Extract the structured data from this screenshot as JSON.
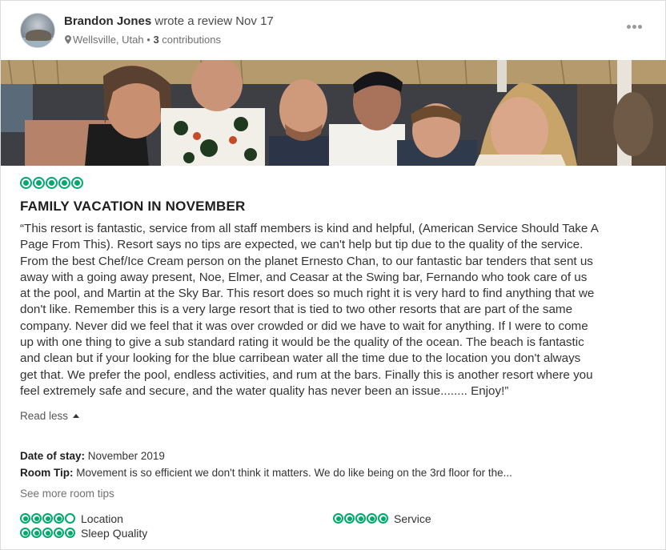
{
  "review": {
    "reviewer_name": "Brandon Jones",
    "action": "wrote a review Nov 17",
    "location": "Wellsville, Utah",
    "separator": "•",
    "contributions_count": "3",
    "contributions_label": "contributions",
    "rating": 5,
    "rating_max": 5,
    "title": "FAMILY VACATION IN NOVEMBER",
    "body_lines": [
      "“This resort is fantastic, service from all staff members is kind and helpful, (American Service Should Take A",
      "Page From This). Resort says no tips are expected, we can't help but tip due to the quality of the service.",
      "From the best Chef/Ice Cream person on the planet Ernesto Chan, to our fantastic bar tenders that sent us",
      "away with a going away present, Noe, Elmer, and Ceasar at the Swing bar, Fernando who took care of us",
      "at the pool, and Martin at the Sky Bar. This resort does so much right it is very hard to find anything that we",
      "don't like. Remember this is a very large resort that is tied to two other resorts that are part of the same",
      "company. Never did we feel that it was over crowded or did we have to wait for anything. If I were to come",
      "up with one thing to give a sub standard rating it would be the quality of the ocean. The beach is fantastic",
      "and clean but if your looking for the blue carribean water all the time due to the location you don't always",
      "get that. We prefer the pool, endless activities, and rum at the bars. Finally this is another resort where you",
      "feel extremely safe and secure, and the water quality has never been an issue........ Enjoy!”"
    ],
    "read_less_label": "Read less",
    "date_of_stay_label": "Date of stay:",
    "date_of_stay_value": "November 2019",
    "room_tip_label": "Room Tip:",
    "room_tip_value": "Movement is so efficient we don't think it matters. We do like being on the 3rd floor for the...",
    "see_more_tips_label": "See more room tips",
    "sub_ratings": [
      {
        "label": "Location",
        "value": 4,
        "max": 5
      },
      {
        "label": "Service",
        "value": 5,
        "max": 5
      },
      {
        "label": "Sleep Quality",
        "value": 5,
        "max": 5
      }
    ]
  },
  "icons": {
    "more": "more-options-icon",
    "pin": "location-pin-icon",
    "caret": "caret-up-icon"
  },
  "colors": {
    "accent_green": "#00aa6c",
    "text": "#2c2c2c",
    "muted": "#6f6f6f"
  }
}
